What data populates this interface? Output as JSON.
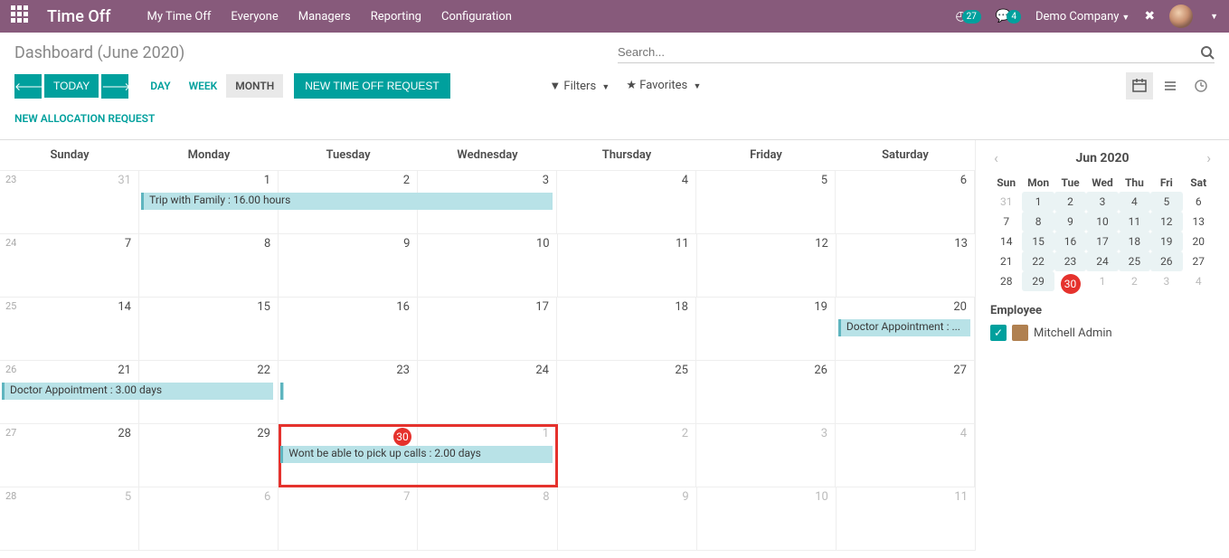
{
  "navbar": {
    "brand": "Time Off",
    "links": [
      "My Time Off",
      "Everyone",
      "Managers",
      "Reporting",
      "Configuration"
    ],
    "badge1": "27",
    "badge2": "4",
    "company": "Demo Company"
  },
  "toolbar": {
    "title": "Dashboard (June 2020)",
    "search_placeholder": "Search...",
    "today": "TODAY",
    "view_day": "DAY",
    "view_week": "WEEK",
    "view_month": "MONTH",
    "new_request": "NEW TIME OFF REQUEST",
    "new_alloc": "NEW ALLOCATION REQUEST",
    "filters": "Filters",
    "favorites": "Favorites"
  },
  "calendar": {
    "days": [
      "Sunday",
      "Monday",
      "Tuesday",
      "Wednesday",
      "Thursday",
      "Friday",
      "Saturday"
    ],
    "weeks": [
      {
        "num": "23",
        "cells": [
          {
            "n": "31",
            "muted": true
          },
          {
            "n": "1"
          },
          {
            "n": "2"
          },
          {
            "n": "3"
          },
          {
            "n": "4"
          },
          {
            "n": "5"
          },
          {
            "n": "6"
          }
        ]
      },
      {
        "num": "24",
        "cells": [
          {
            "n": "7"
          },
          {
            "n": "8"
          },
          {
            "n": "9"
          },
          {
            "n": "10"
          },
          {
            "n": "11"
          },
          {
            "n": "12"
          },
          {
            "n": "13"
          }
        ]
      },
      {
        "num": "25",
        "cells": [
          {
            "n": "14"
          },
          {
            "n": "15"
          },
          {
            "n": "16"
          },
          {
            "n": "17"
          },
          {
            "n": "18"
          },
          {
            "n": "19"
          },
          {
            "n": "20"
          }
        ]
      },
      {
        "num": "26",
        "cells": [
          {
            "n": "21"
          },
          {
            "n": "22"
          },
          {
            "n": "23"
          },
          {
            "n": "24"
          },
          {
            "n": "25"
          },
          {
            "n": "26"
          },
          {
            "n": "27"
          }
        ]
      },
      {
        "num": "27",
        "cells": [
          {
            "n": "28"
          },
          {
            "n": "29"
          },
          {
            "n": "30",
            "today": true
          },
          {
            "n": "1",
            "muted": true
          },
          {
            "n": "2",
            "muted": true
          },
          {
            "n": "3",
            "muted": true
          },
          {
            "n": "4",
            "muted": true
          }
        ]
      },
      {
        "num": "28",
        "cells": [
          {
            "n": "5",
            "muted": true
          },
          {
            "n": "6",
            "muted": true
          },
          {
            "n": "7",
            "muted": true
          },
          {
            "n": "8",
            "muted": true
          },
          {
            "n": "9",
            "muted": true
          },
          {
            "n": "10",
            "muted": true
          },
          {
            "n": "11",
            "muted": true
          }
        ]
      }
    ],
    "events": {
      "trip": "Trip with Family : 16.00 hours",
      "doctor_short": "Doctor Appointment : ...",
      "doctor_long": "Doctor Appointment : 3.00 days",
      "calls": "Wont be able to pick up calls : 2.00 days"
    }
  },
  "mini": {
    "title": "Jun 2020",
    "days": [
      "Sun",
      "Mon",
      "Tue",
      "Wed",
      "Thu",
      "Fri",
      "Sat"
    ],
    "rows": [
      [
        {
          "n": "31",
          "out": true
        },
        {
          "n": "1",
          "wd": true
        },
        {
          "n": "2",
          "wd": true
        },
        {
          "n": "3",
          "wd": true
        },
        {
          "n": "4",
          "wd": true
        },
        {
          "n": "5",
          "wd": true
        },
        {
          "n": "6"
        }
      ],
      [
        {
          "n": "7"
        },
        {
          "n": "8",
          "wd": true
        },
        {
          "n": "9",
          "wd": true
        },
        {
          "n": "10",
          "wd": true
        },
        {
          "n": "11",
          "wd": true
        },
        {
          "n": "12",
          "wd": true
        },
        {
          "n": "13"
        }
      ],
      [
        {
          "n": "14"
        },
        {
          "n": "15",
          "wd": true
        },
        {
          "n": "16",
          "wd": true
        },
        {
          "n": "17",
          "wd": true
        },
        {
          "n": "18",
          "wd": true
        },
        {
          "n": "19",
          "wd": true
        },
        {
          "n": "20"
        }
      ],
      [
        {
          "n": "21"
        },
        {
          "n": "22",
          "wd": true
        },
        {
          "n": "23",
          "wd": true
        },
        {
          "n": "24",
          "wd": true
        },
        {
          "n": "25",
          "wd": true
        },
        {
          "n": "26",
          "wd": true
        },
        {
          "n": "27"
        }
      ],
      [
        {
          "n": "28"
        },
        {
          "n": "29",
          "wd": true
        },
        {
          "n": "30",
          "today": true
        },
        {
          "n": "1",
          "out": true
        },
        {
          "n": "2",
          "out": true
        },
        {
          "n": "3",
          "out": true
        },
        {
          "n": "4",
          "out": true
        }
      ]
    ]
  },
  "employee": {
    "label": "Employee",
    "name": "Mitchell Admin"
  }
}
